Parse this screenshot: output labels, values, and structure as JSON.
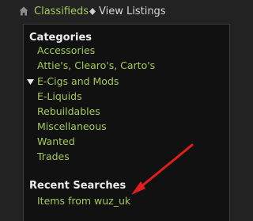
{
  "breadcrumb": {
    "home_icon": "home-icon",
    "separator_icon": "diamond-arrow-icon",
    "link_label": "Classifieds",
    "current_label": "View Listings"
  },
  "categories": {
    "heading": "Categories",
    "items": [
      {
        "label": "Accessories"
      },
      {
        "label": "Attie's, Clearo's, Carto's"
      },
      {
        "label": "E-Cigs and Mods",
        "expanded": true
      },
      {
        "label": "E-Liquids"
      },
      {
        "label": "Rebuildables"
      },
      {
        "label": "Miscellaneous"
      },
      {
        "label": "Wanted"
      },
      {
        "label": "Trades"
      }
    ]
  },
  "recent_searches": {
    "heading": "Recent Searches",
    "items": [
      {
        "label": "Items from wuz_uk"
      }
    ]
  },
  "colors": {
    "background": "#222222",
    "panel": "#111111",
    "link": "#a6c95a",
    "heading": "#ececec",
    "annotation_arrow": "#e31c1c"
  }
}
